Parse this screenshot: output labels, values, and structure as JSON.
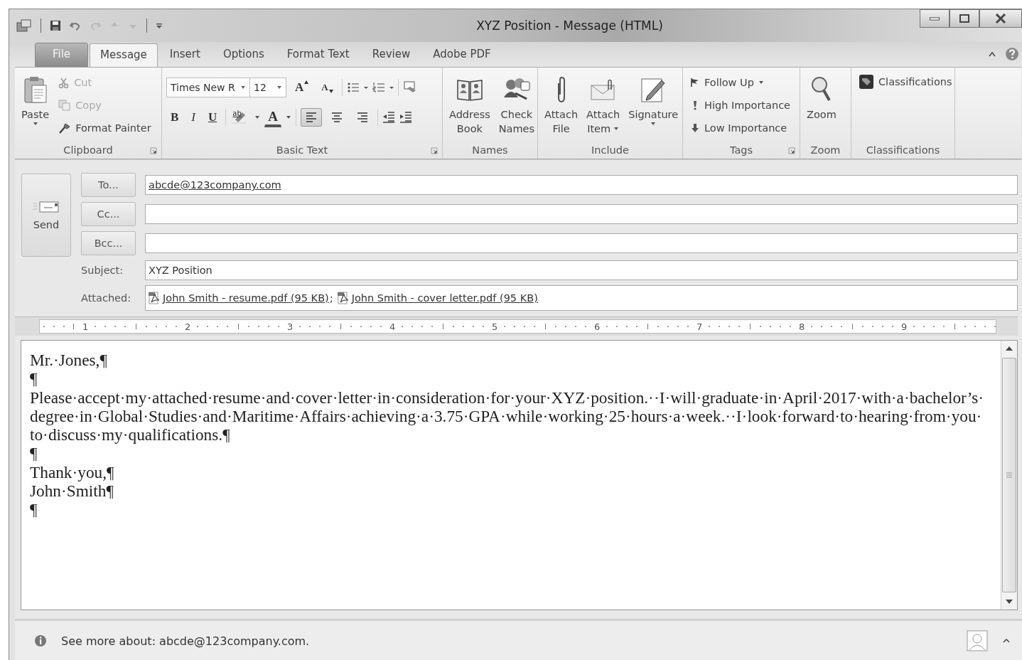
{
  "window": {
    "title": "XYZ Position - Message (HTML)"
  },
  "tabs": [
    {
      "label": "File",
      "kind": "file",
      "selected": false
    },
    {
      "label": "Message",
      "kind": "tab",
      "selected": true
    },
    {
      "label": "Insert",
      "kind": "tab",
      "selected": false
    },
    {
      "label": "Options",
      "kind": "tab",
      "selected": false
    },
    {
      "label": "Format Text",
      "kind": "tab",
      "selected": false
    },
    {
      "label": "Review",
      "kind": "tab",
      "selected": false
    },
    {
      "label": "Adobe PDF",
      "kind": "tab",
      "selected": false
    }
  ],
  "ribbon": {
    "groups": [
      {
        "label": "Clipboard",
        "kind": "controls",
        "launcher": true,
        "controls": [
          {
            "kind": "large",
            "lines": [
              "Paste"
            ],
            "dropdown": true,
            "disabled": false
          },
          {
            "kind": "small",
            "lines": [
              "Cut"
            ],
            "dropdown": false,
            "disabled": true
          },
          {
            "kind": "small",
            "lines": [
              "Copy"
            ],
            "dropdown": false,
            "disabled": true
          },
          {
            "kind": "small",
            "lines": [
              "Format Painter"
            ],
            "dropdown": false,
            "disabled": false
          }
        ]
      },
      {
        "label": "Basic Text",
        "kind": "font",
        "launcher": true,
        "font": "Times New R",
        "size": "12",
        "grow": "A",
        "shrink": "A",
        "highlight": "ab",
        "font_color": "A",
        "format": [
          {
            "label": "B"
          },
          {
            "label": "I"
          },
          {
            "label": "U"
          }
        ],
        "align": [
          {
            "selected": true
          },
          {
            "selected": false
          },
          {
            "selected": false
          }
        ]
      },
      {
        "label": "Names",
        "kind": "controls",
        "launcher": false,
        "controls": [
          {
            "kind": "large",
            "lines": [
              "Address",
              "Book"
            ],
            "dropdown": false,
            "disabled": false
          },
          {
            "kind": "large",
            "lines": [
              "Check",
              "Names"
            ],
            "dropdown": false,
            "disabled": false
          }
        ]
      },
      {
        "label": "Include",
        "kind": "controls",
        "launcher": false,
        "controls": [
          {
            "kind": "large",
            "lines": [
              "Attach",
              "File"
            ],
            "dropdown": false,
            "disabled": false
          },
          {
            "kind": "large",
            "lines": [
              "Attach",
              "Item"
            ],
            "dropdown": true,
            "disabled": false
          },
          {
            "kind": "large",
            "lines": [
              "Signature"
            ],
            "dropdown": true,
            "disabled": false
          }
        ]
      },
      {
        "label": "Tags",
        "kind": "controls",
        "launcher": true,
        "controls": [
          {
            "kind": "small",
            "lines": [
              "Follow Up"
            ],
            "dropdown": true,
            "disabled": false
          },
          {
            "kind": "small",
            "lines": [
              "High Importance"
            ],
            "dropdown": false,
            "disabled": false
          },
          {
            "kind": "small",
            "lines": [
              "Low Importance"
            ],
            "dropdown": false,
            "disabled": false
          }
        ]
      },
      {
        "label": "Zoom",
        "kind": "controls",
        "launcher": false,
        "controls": [
          {
            "kind": "large",
            "lines": [
              "Zoom"
            ],
            "dropdown": false,
            "disabled": false
          }
        ]
      },
      {
        "label": "Classifications",
        "kind": "controls",
        "launcher": false,
        "controls": [
          {
            "kind": "small",
            "lines": [
              "Classifications"
            ],
            "dropdown": false,
            "disabled": false
          }
        ]
      }
    ]
  },
  "compose": {
    "send": "Send",
    "recipients": [
      {
        "button": "To...",
        "value": "abcde@123company.com"
      },
      {
        "button": "Cc..."
      },
      {
        "button": "Bcc..."
      }
    ],
    "subject": {
      "label": "Subject:",
      "value": "XYZ Position"
    },
    "attached": {
      "label": "Attached:",
      "separator": ";",
      "files": [
        {
          "name": "John Smith - resume.pdf (95 KB)"
        },
        {
          "name": "John Smith - cover letter.pdf (95 KB)"
        }
      ]
    }
  },
  "ruler": {
    "labels": [
      "1",
      "2",
      "3",
      "4",
      "5",
      "6",
      "7",
      "8",
      "9"
    ]
  },
  "body": {
    "paragraphs": [
      "Mr.·Jones,¶",
      "¶",
      "Please·accept·my·attached·resume·and·cover·letter·in·consideration·for·your·XYZ·position.··I·will·graduate·in·April·2017·with·a·bachelor’s·degree·in·Global·Studies·and·Maritime·Affairs·achieving·a·3.75·GPA·while·working·25·hours·a·week.··I·look·forward·to·hearing·from·you·to·discuss·my·qualifications.¶",
      "¶",
      "Thank·you,¶",
      "John·Smith¶",
      "¶"
    ]
  },
  "status_bar": {
    "text": "See more about: abcde@123company.com."
  }
}
